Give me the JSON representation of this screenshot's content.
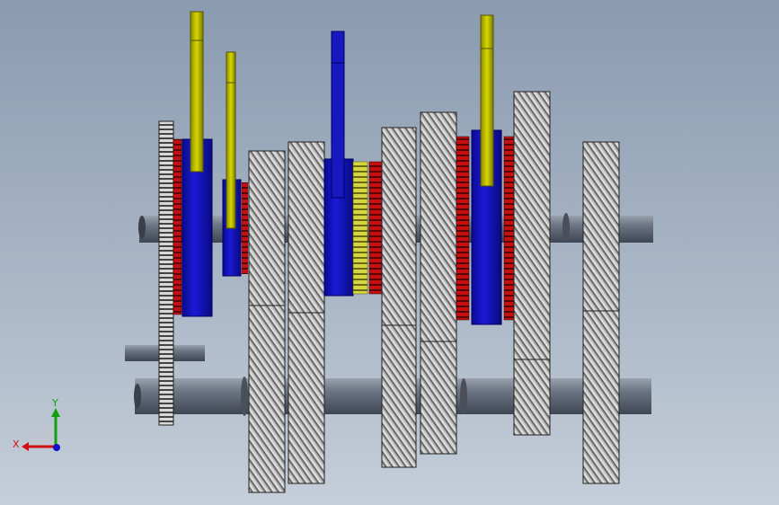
{
  "window": {
    "title": ""
  },
  "colors": {
    "background_top": "#8a9ab0",
    "background_bottom": "#c5ced9",
    "shaft": "#5f6877",
    "helical_gear_face": "#c9c9c9",
    "helical_gear_line": "#3a3a3a",
    "synchronizer_sleeve": "#1010c8",
    "synchro_cone_red": "#c41010",
    "shift_fork_rod": "#c8c800",
    "idler_yellow": "#d6d640",
    "axis_x": "#d01010",
    "axis_y": "#10a010",
    "axis_z": "#1010d0"
  },
  "triad": {
    "x_label": "X",
    "y_label": "Y",
    "icon": "coordinate-triad-icon"
  },
  "components": {
    "upper_shaft": "main-shaft",
    "lower_shaft": "counter-shaft",
    "short_shaft": "reverse-idler-shaft",
    "forks": [
      "shift-fork-1-2",
      "shift-fork-3-4",
      "shift-fork-5-6",
      "shift-fork-reverse"
    ]
  }
}
